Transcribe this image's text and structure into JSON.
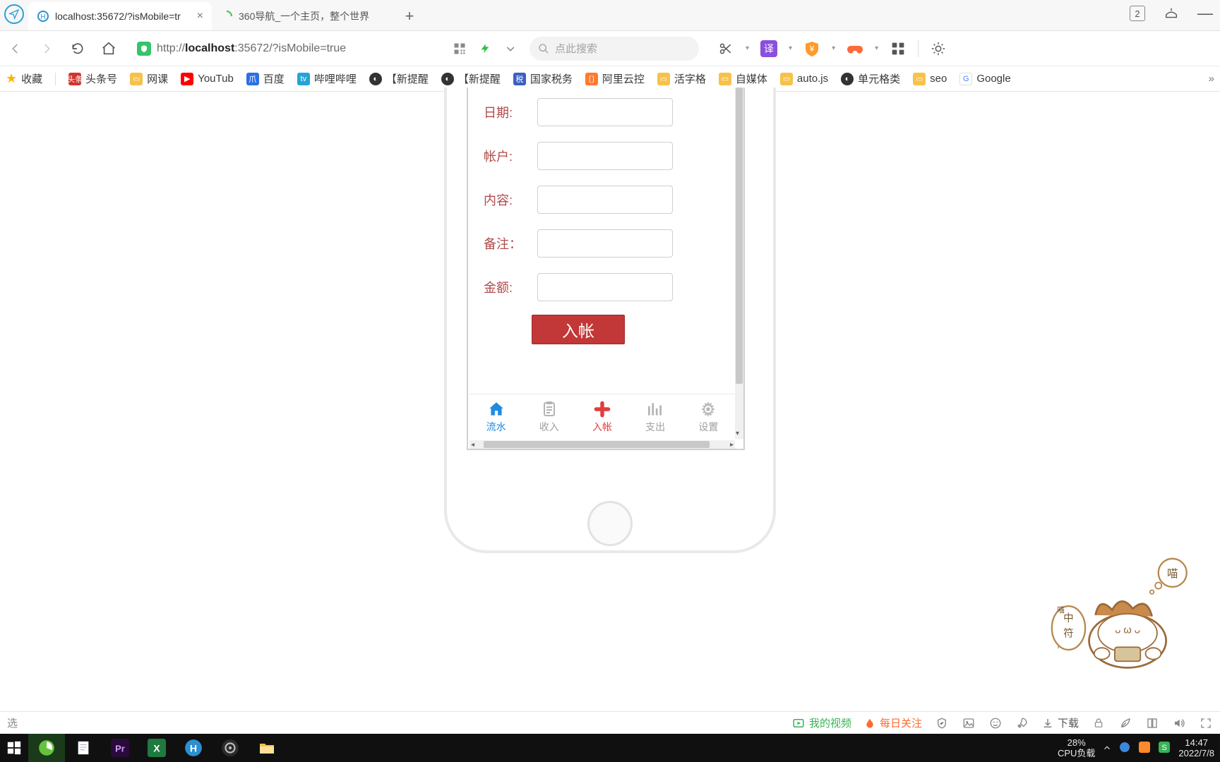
{
  "tabs": [
    {
      "title": "localhost:35672/?isMobile=tr"
    },
    {
      "title": "360导航_一个主页，整个世界"
    }
  ],
  "win_badge": "2",
  "url": {
    "prefix": "http://",
    "host": "localhost",
    "rest": ":35672/?isMobile=true"
  },
  "search_placeholder": "点此搜索",
  "toolbar": {
    "translate": "译"
  },
  "bookmarks": {
    "fav": "收藏",
    "items": [
      "头条号",
      "网课",
      "YouTub",
      "百度",
      "哔哩哔哩",
      "【新提醒",
      "【新提醒",
      "国家税务",
      "阿里云控",
      "活字格",
      "自媒体",
      "auto.js",
      "单元格类",
      "seo",
      "Google"
    ]
  },
  "form": {
    "date": "日期:",
    "account": "帐户:",
    "content": "内容:",
    "note": "备注：",
    "amount": "金额:",
    "submit": "入帐"
  },
  "tabbar": {
    "flow": "流水",
    "income": "收入",
    "entry": "入帐",
    "expense": "支出",
    "settings": "设置"
  },
  "status": {
    "left": "选",
    "video": "我的视频",
    "daily": "每日关注",
    "download": "下载"
  },
  "tray": {
    "cpu_pct": "28%",
    "cpu_lbl": "CPU负载",
    "time": "14:47",
    "date": "2022/7/8"
  },
  "sticker": {
    "bubble1": "喵",
    "bubble2a": "中",
    "bubble2b": "符",
    "face": "ᴗ ω ᴗ",
    "word": "喵"
  }
}
